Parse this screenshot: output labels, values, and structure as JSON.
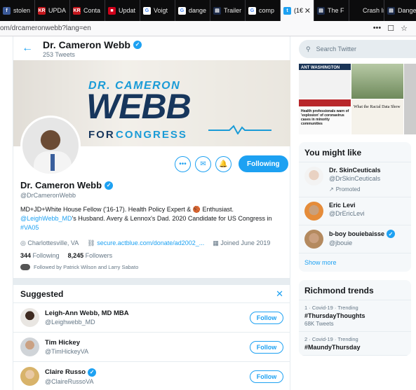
{
  "browser": {
    "tabs": [
      {
        "label": "stolen",
        "color": "#3b5998",
        "glyph": "f"
      },
      {
        "label": "UPDA",
        "color": "#c4161c",
        "glyph": "KR"
      },
      {
        "label": "Conta",
        "color": "#c4161c",
        "glyph": "KR"
      },
      {
        "label": "Updat",
        "color": "#d0021b",
        "glyph": "■"
      },
      {
        "label": "Voigt",
        "color": "#fff",
        "glyph": "G"
      },
      {
        "label": "dange",
        "color": "#fff",
        "glyph": "G"
      },
      {
        "label": "Trailer",
        "color": "#1c2a48",
        "glyph": "▤"
      },
      {
        "label": "comp",
        "color": "#fff",
        "glyph": "G"
      },
      {
        "label": "(1€",
        "color": "#1da1f2",
        "glyph": "t"
      },
      {
        "label": "The F",
        "color": "#1c2a48",
        "glyph": "▤"
      },
      {
        "label": "Crash Inve",
        "color": "#0c0c0d",
        "glyph": ""
      },
      {
        "label": "Dange",
        "color": "#1c2a48",
        "glyph": "▤"
      }
    ],
    "active_tab_close": "✕",
    "url": "om/drcameronwebb?lang=en",
    "url_icons": [
      "•••",
      "☐",
      "☆"
    ]
  },
  "profile": {
    "header_name": "Dr. Cameron Webb",
    "tweet_count": "253 Tweets",
    "banner": {
      "dr": "DR. CAMERON",
      "webb": "WEBB",
      "for": "FOR",
      "congress": "CONGRESS"
    },
    "name": "Dr. Cameron Webb",
    "handle": "@DrCameronWebb",
    "bio_line1": "MD+JD+White House Fellow ('16-17). Health Policy Expert & 🏀 Enthusiast.",
    "bio_link1": "@LeighWebb_MD",
    "bio_line2": "'s Husband. Avery & Lennox's Dad. 2020 Candidate for US Congress in",
    "bio_link2": "#VA05",
    "location": "Charlottesville, VA",
    "website": "secure.actblue.com/donate/ad2002_...",
    "joined": "Joined June 2019",
    "following_count": "344",
    "following_label": "Following",
    "followers_count": "8,245",
    "followers_label": "Followers",
    "followed_by": "Followed by Patrick Wilson and Larry Sabato",
    "follow_button": "Following",
    "more_icon": "•••",
    "message_icon": "✉",
    "notify_icon": "🔔"
  },
  "suggested": {
    "title": "Suggested",
    "close": "✕",
    "follow_label": "Follow",
    "items": [
      {
        "name": "Leigh-Ann Webb, MD MBA",
        "handle": "@Leighwebb_MD",
        "verified": false
      },
      {
        "name": "Tim Hickey",
        "handle": "@TimHickeyVA",
        "verified": false
      },
      {
        "name": "Claire Russo",
        "handle": "@ClaireRussoVA",
        "verified": true
      }
    ]
  },
  "sidebar": {
    "search_placeholder": "Search Twitter",
    "media": {
      "m1_title": "ANT WASHINGTON",
      "m4_title": "Health professionals warn of 'explosion' of coronavirus cases in minority communities",
      "m5_title": "What the Racial Data Show"
    },
    "might_like": {
      "title": "You might like",
      "items": [
        {
          "name": "Dr. SkinCeuticals",
          "handle": "@DrSkinCeuticals",
          "promoted": "Promoted",
          "verified": false
        },
        {
          "name": "Eric Levi",
          "handle": "@DrEricLevi",
          "promoted": "",
          "verified": false
        },
        {
          "name": "b-boy bouiebaisse",
          "handle": "@jbouie",
          "promoted": "",
          "verified": true
        }
      ],
      "show_more": "Show more"
    },
    "trends": {
      "title": "Richmond trends",
      "items": [
        {
          "context": "1 · Covid-19 · Trending",
          "topic": "#ThursdayThoughts",
          "count": "68K Tweets"
        },
        {
          "context": "2 · Covid-19 · Trending",
          "topic": "#MaundyThursday",
          "count": ""
        }
      ]
    }
  }
}
